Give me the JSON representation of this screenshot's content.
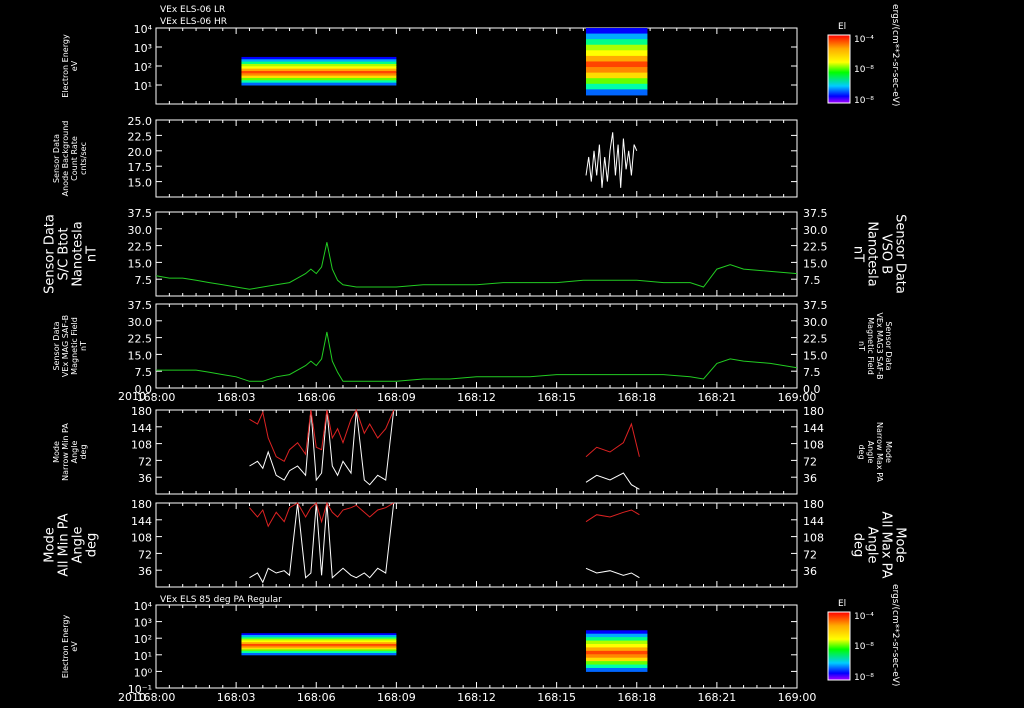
{
  "colors": {
    "bg": "#000000",
    "axis": "#ffffff",
    "green": "#22cc22",
    "red": "#dd2222",
    "white": "#ffffff"
  },
  "titles": {
    "top1": "VEx ELS-06 LR",
    "top2": "VEx ELS-06 HR",
    "bottom": "VEx ELS 85 deg PA Regular"
  },
  "colorbar": {
    "label": "El",
    "unit": "ergs/(cm**2-sr-sec-eV)",
    "ticks": [
      "10⁻⁴",
      "10⁻⁸",
      "10⁻⁸"
    ]
  },
  "year_label": "2010",
  "time_ticks": [
    "168:00",
    "168:03",
    "168:06",
    "168:09",
    "168:12",
    "168:15",
    "168:18",
    "168:21",
    "169:00"
  ],
  "chart_data": [
    {
      "type": "heatmap",
      "title": "VEx ELS-06 LR / VEx ELS-06 HR",
      "ylabel_lines": [
        "Electron Energy",
        "eV"
      ],
      "y_ticks": [
        "10⁴",
        "10³",
        "10²",
        "10¹"
      ],
      "ylim": [
        1,
        10000
      ],
      "log_y": true,
      "intervals": [
        {
          "start": "168:03.2",
          "end": "168:09.0",
          "e_min": 10,
          "e_max": 300
        },
        {
          "start": "168:16.1",
          "end": "168:18.4",
          "e_min": 3,
          "e_max": 10000
        }
      ]
    },
    {
      "type": "line",
      "ylabel_lines": [
        "Sensor Data",
        "Anode Background",
        "Count Rate",
        "cnts/sec"
      ],
      "y_ticks": [
        "25.0",
        "22.5",
        "20.0",
        "17.5",
        "15.0"
      ],
      "ylim": [
        12.5,
        25.0
      ],
      "series": [
        {
          "color": "#ffffff",
          "x": [
            16.1,
            16.2,
            16.3,
            16.4,
            16.5,
            16.6,
            16.7,
            16.8,
            16.9,
            17.0,
            17.1,
            17.2,
            17.3,
            17.4,
            17.5,
            17.6,
            17.7,
            17.8,
            17.9,
            18.0
          ],
          "values": [
            16,
            19,
            15,
            20,
            16,
            21,
            14,
            19,
            15,
            20,
            23,
            16,
            21,
            14,
            22,
            17,
            20,
            16,
            21,
            20
          ]
        }
      ]
    },
    {
      "type": "line",
      "ylabel_lines": [
        "Sensor Data",
        "S/C Btot",
        "Nanotesla",
        "nT"
      ],
      "right_label_lines": [
        "Sensor Data",
        "VSO B",
        "Nanotesla",
        "nT"
      ],
      "y_ticks": [
        "37.5",
        "30.0",
        "22.5",
        "15.0",
        "7.5"
      ],
      "ylim": [
        0,
        37.5
      ],
      "series": [
        {
          "color": "#22cc22",
          "x": [
            0,
            0.5,
            1,
            1.5,
            2,
            2.5,
            3,
            3.5,
            4,
            4.5,
            5,
            5.3,
            5.6,
            5.8,
            6.0,
            6.2,
            6.4,
            6.6,
            6.8,
            7.0,
            7.5,
            8,
            9,
            10,
            11,
            12,
            13,
            14,
            15,
            16,
            17,
            18,
            19,
            20,
            20.5,
            21,
            21.5,
            22,
            23,
            24
          ],
          "values": [
            9,
            8,
            8,
            7,
            6,
            5,
            4,
            3,
            4,
            5,
            6,
            8,
            10,
            12,
            10,
            13,
            24,
            12,
            7,
            5,
            4,
            4,
            4,
            5,
            5,
            5,
            6,
            6,
            6,
            7,
            7,
            7,
            6,
            6,
            4,
            12,
            14,
            12,
            11,
            10
          ]
        }
      ]
    },
    {
      "type": "line",
      "ylabel_lines": [
        "Sensor Data",
        "VEx MAG SAF-B",
        "Magnetic Field",
        "nT"
      ],
      "right_label_lines": [
        "Sensor Data",
        "VEx MAG3 SAF-B",
        "Magnetic Field",
        "nT"
      ],
      "y_ticks": [
        "37.5",
        "30.0",
        "22.5",
        "15.0",
        "7.5",
        "0.0"
      ],
      "ylim": [
        0,
        37.5
      ],
      "series": [
        {
          "color": "#22cc22",
          "x": [
            0,
            0.5,
            1,
            1.5,
            2,
            2.5,
            3,
            3.5,
            4,
            4.5,
            5,
            5.3,
            5.6,
            5.8,
            6.0,
            6.2,
            6.4,
            6.6,
            6.8,
            7.0,
            7.5,
            8,
            9,
            10,
            11,
            12,
            13,
            14,
            15,
            16,
            17,
            18,
            19,
            20,
            20.5,
            21,
            21.5,
            22,
            23,
            24
          ],
          "values": [
            8,
            8,
            8,
            8,
            7,
            6,
            5,
            3,
            3,
            5,
            6,
            8,
            10,
            12,
            10,
            13,
            25,
            12,
            7,
            3,
            3,
            3,
            3,
            4,
            4,
            5,
            5,
            5,
            6,
            6,
            6,
            6,
            6,
            5,
            4,
            11,
            13,
            12,
            11,
            9
          ]
        }
      ]
    },
    {
      "type": "line",
      "ylabel_lines": [
        "Mode",
        "Narrow Min PA",
        "Angle",
        "deg"
      ],
      "right_label_lines": [
        "Mode",
        "Narrow Max PA",
        "Angle",
        "deg"
      ],
      "y_ticks": [
        "180",
        "144",
        "108",
        "72",
        "36"
      ],
      "ylim": [
        0,
        180
      ],
      "series": [
        {
          "name": "Min",
          "color": "#ffffff",
          "x": [
            3.5,
            3.8,
            4.0,
            4.2,
            4.5,
            4.8,
            5.0,
            5.3,
            5.6,
            5.8,
            6.0,
            6.2,
            6.4,
            6.6,
            6.8,
            7.0,
            7.3,
            7.5,
            7.8,
            8.0,
            8.3,
            8.6,
            8.9,
            16.1,
            16.5,
            17.0,
            17.5,
            17.8,
            18.1
          ],
          "values": [
            60,
            70,
            55,
            90,
            40,
            30,
            50,
            60,
            40,
            180,
            30,
            45,
            180,
            60,
            40,
            70,
            45,
            180,
            30,
            20,
            40,
            30,
            180,
            25,
            40,
            30,
            45,
            20,
            10
          ]
        },
        {
          "name": "Max",
          "color": "#dd2222",
          "x": [
            3.5,
            3.8,
            4.0,
            4.2,
            4.5,
            4.8,
            5.0,
            5.3,
            5.6,
            5.8,
            6.0,
            6.2,
            6.4,
            6.6,
            6.8,
            7.0,
            7.3,
            7.5,
            7.8,
            8.0,
            8.3,
            8.6,
            8.9,
            16.1,
            16.5,
            17.0,
            17.5,
            17.8,
            18.1
          ],
          "values": [
            160,
            150,
            175,
            120,
            80,
            70,
            95,
            110,
            85,
            180,
            100,
            95,
            180,
            120,
            140,
            110,
            160,
            180,
            130,
            150,
            120,
            140,
            180,
            80,
            100,
            90,
            110,
            150,
            80
          ]
        }
      ]
    },
    {
      "type": "line",
      "ylabel_lines": [
        "Mode",
        "All Min PA",
        "Angle",
        "deg"
      ],
      "right_label_lines": [
        "Mode",
        "All Max PA",
        "Angle",
        "deg"
      ],
      "y_ticks": [
        "180",
        "144",
        "108",
        "72",
        "36"
      ],
      "ylim": [
        0,
        180
      ],
      "series": [
        {
          "name": "Min",
          "color": "#ffffff",
          "x": [
            3.5,
            3.8,
            4.0,
            4.2,
            4.5,
            4.8,
            5.0,
            5.3,
            5.6,
            5.8,
            6.0,
            6.2,
            6.4,
            6.6,
            6.8,
            7.0,
            7.3,
            7.5,
            7.8,
            8.0,
            8.3,
            8.6,
            8.9,
            16.1,
            16.5,
            17.0,
            17.5,
            17.8,
            18.1
          ],
          "values": [
            20,
            30,
            10,
            40,
            30,
            35,
            25,
            180,
            20,
            30,
            180,
            25,
            180,
            20,
            30,
            40,
            25,
            20,
            30,
            20,
            40,
            30,
            180,
            40,
            30,
            35,
            25,
            30,
            20
          ]
        },
        {
          "name": "Max",
          "color": "#dd2222",
          "x": [
            3.5,
            3.8,
            4.0,
            4.2,
            4.5,
            4.8,
            5.0,
            5.3,
            5.6,
            5.8,
            6.0,
            6.2,
            6.4,
            6.6,
            6.8,
            7.0,
            7.3,
            7.5,
            7.8,
            8.0,
            8.3,
            8.6,
            8.9,
            16.1,
            16.5,
            17.0,
            17.5,
            17.8,
            18.1
          ],
          "values": [
            170,
            150,
            165,
            130,
            160,
            140,
            170,
            180,
            150,
            170,
            180,
            140,
            180,
            160,
            150,
            165,
            170,
            175,
            160,
            150,
            165,
            170,
            180,
            140,
            155,
            150,
            160,
            165,
            155
          ]
        }
      ]
    },
    {
      "type": "heatmap",
      "title": "VEx ELS 85 deg PA Regular",
      "ylabel_lines": [
        "Electron Energy",
        "eV"
      ],
      "y_ticks": [
        "10⁴",
        "10³",
        "10²",
        "10¹",
        "10⁰",
        "10⁻¹"
      ],
      "ylim": [
        0.1,
        10000
      ],
      "log_y": true,
      "intervals": [
        {
          "start": "168:03.2",
          "end": "168:09.0",
          "e_min": 10,
          "e_max": 200
        },
        {
          "start": "168:16.1",
          "end": "168:18.4",
          "e_min": 1,
          "e_max": 300
        }
      ]
    }
  ]
}
